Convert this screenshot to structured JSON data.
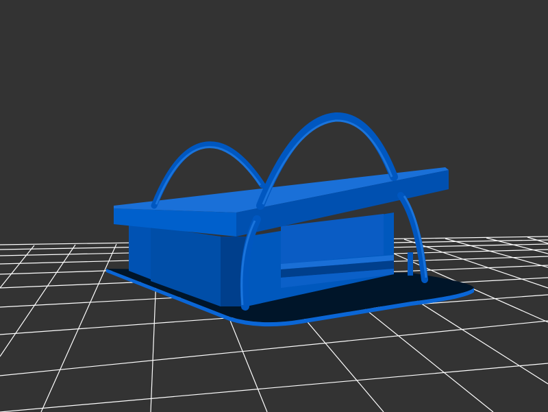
{
  "viewer": {
    "background_color": "#333333",
    "grid_color": "#ffffff",
    "grid_visible": true
  },
  "model": {
    "primary_color": "#0055b8",
    "highlight_color": "#1a6fd6",
    "shadow_color": "#003f8c",
    "dark_interior_color": "#001a33",
    "base_color": "#001529"
  }
}
